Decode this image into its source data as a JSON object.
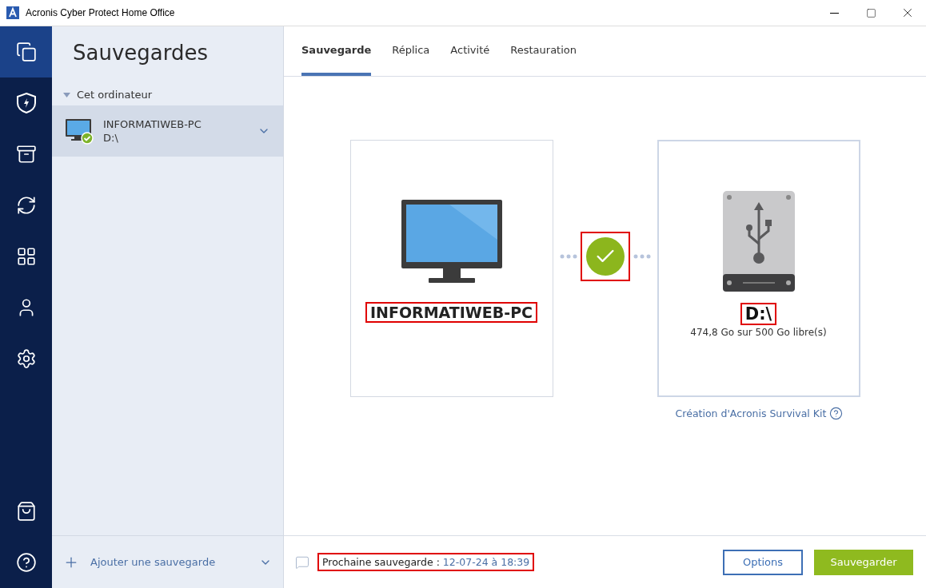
{
  "window": {
    "title": "Acronis Cyber Protect Home Office"
  },
  "nav": [
    {
      "kind": "backups",
      "selected": true
    },
    {
      "kind": "protection",
      "selected": false
    },
    {
      "kind": "archive",
      "selected": false
    },
    {
      "kind": "sync",
      "selected": false
    },
    {
      "kind": "tools",
      "selected": false
    },
    {
      "kind": "account",
      "selected": false
    },
    {
      "kind": "settings",
      "selected": false
    },
    {
      "kind": "store",
      "selected": false
    },
    {
      "kind": "help",
      "selected": false
    }
  ],
  "sidebar": {
    "title": "Sauvegardes",
    "group": {
      "label": "Cet ordinateur",
      "expanded": true
    },
    "items": [
      {
        "name": "INFORMATIWEB-PC",
        "destination": "D:\\",
        "selected": true,
        "succeeded": true
      }
    ],
    "add_label": "Ajouter une sauvegarde"
  },
  "tabs": [
    {
      "label": "Sauvegarde",
      "selected": true
    },
    {
      "label": "Réplica",
      "selected": false
    },
    {
      "label": "Activité",
      "selected": false
    },
    {
      "label": "Restauration",
      "selected": false
    }
  ],
  "source": {
    "name": "INFORMATIWEB-PC",
    "highlighted": true
  },
  "connection": {
    "succeeded": true,
    "highlighted": true
  },
  "destination": {
    "name": "D:\\",
    "highlighted": true,
    "free": "474,8 Go sur 500 Go libre(s)"
  },
  "survival_kit_link": "Création d'Acronis Survival Kit",
  "footer": {
    "next_label": "Prochaine sauvegarde :",
    "next_value": "12-07-24 à 18:39",
    "highlighted": true
  },
  "buttons": [
    {
      "kind": "secondary",
      "label": "Options"
    },
    {
      "kind": "primary",
      "label": "Sauvegarder"
    }
  ]
}
